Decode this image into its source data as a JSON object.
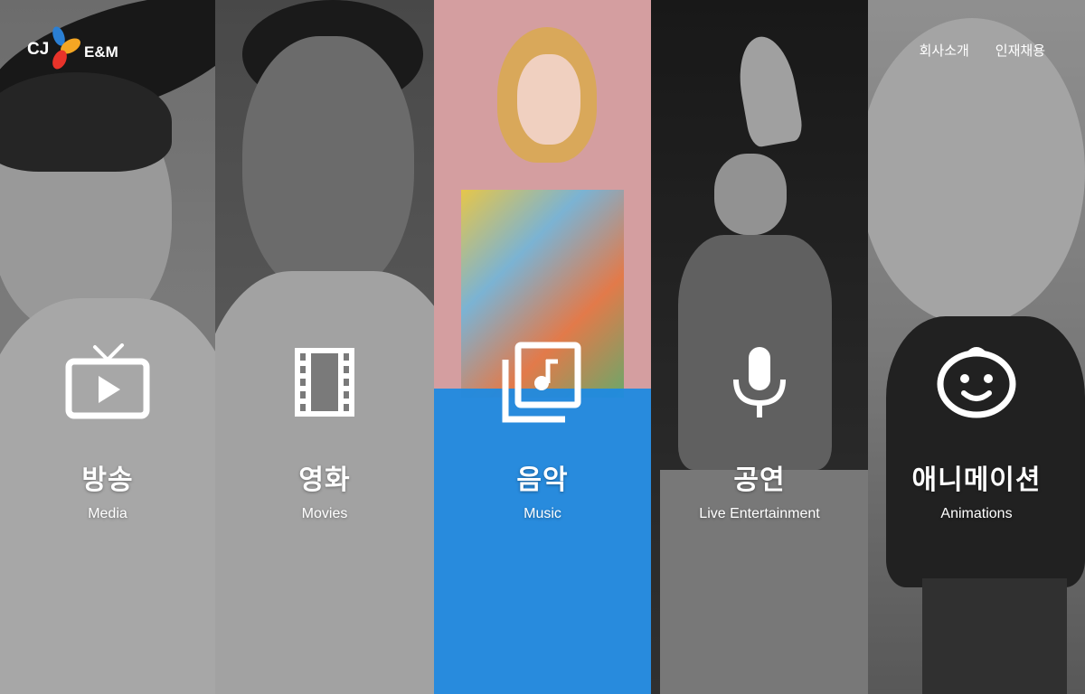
{
  "brand": {
    "cj": "CJ",
    "em": "E&M"
  },
  "topnav": {
    "about": "회사소개",
    "careers": "인재채용"
  },
  "panels": [
    {
      "ko": "방송",
      "en": "Media",
      "icon": "tv-icon"
    },
    {
      "ko": "영화",
      "en": "Movies",
      "icon": "film-strip-icon"
    },
    {
      "ko": "음악",
      "en": "Music",
      "icon": "music-album-icon"
    },
    {
      "ko": "공연",
      "en": "Live Entertainment",
      "icon": "microphone-icon"
    },
    {
      "ko": "애니메이션",
      "en": "Animations",
      "icon": "baby-face-icon"
    }
  ],
  "colors": {
    "music_highlight": "#1f8ae0",
    "logo_blue": "#2a7fd4",
    "logo_red": "#e8332a",
    "logo_orange": "#f5a623"
  }
}
